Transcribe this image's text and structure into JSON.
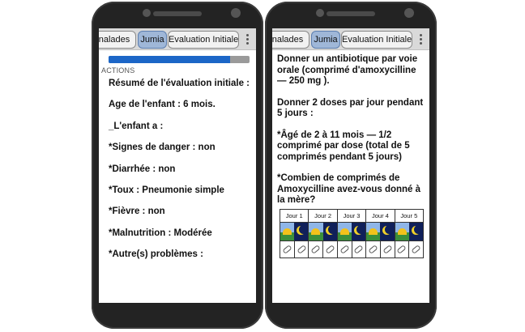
{
  "left_phone": {
    "tabs": [
      {
        "label": "nalades",
        "active": false
      },
      {
        "label": "Jumia",
        "active": true
      },
      {
        "label": "Evaluation Initiale",
        "active": false
      }
    ],
    "progress_fraction": 0.86,
    "section_label": "ACTIONS",
    "lines": [
      "Résumé de l'évaluation initiale :",
      "Age de l'enfant : 6 mois.",
      "_L'enfant a :",
      "*Signes de danger : non",
      "*Diarrhée : non",
      "*Toux : Pneumonie simple",
      "*Fièvre : non",
      "*Malnutrition : Modérée",
      "*Autre(s) problèmes :"
    ]
  },
  "right_phone": {
    "tabs": [
      {
        "label": "nalades",
        "active": false
      },
      {
        "label": "Jumia",
        "active": true
      },
      {
        "label": "Evaluation Initiale",
        "active": false
      }
    ],
    "paragraphs": [
      "Donner un antibiotique par voie orale (comprimé d'amoxycilline — 250 mg ).",
      "Donner 2 doses par jour pendant 5 jours :",
      "*Âgé de 2 à 11 mois — 1/2 comprimé par dose (total de 5 comprimés pendant 5 jours)",
      "*Combien de comprimés de Amoxycilline avez-vous donné à la mère?"
    ],
    "calendar_days": [
      "Jour 1",
      "Jour 2",
      "Jour 3",
      "Jour 4",
      "Jour 5"
    ]
  },
  "colors": {
    "phone_body": "#232323",
    "tab_active": "#9fb7d8",
    "progress_fill": "#1c66c7",
    "progress_track": "#9a9a9a",
    "day_sky": "#8fb6e8",
    "night_sky": "#10205a"
  },
  "icons": {
    "overflow_menu": "more-vert-icon",
    "sun": "sun-icon",
    "moon": "moon-icon",
    "checkbox": "pill-checkbox-icon"
  }
}
